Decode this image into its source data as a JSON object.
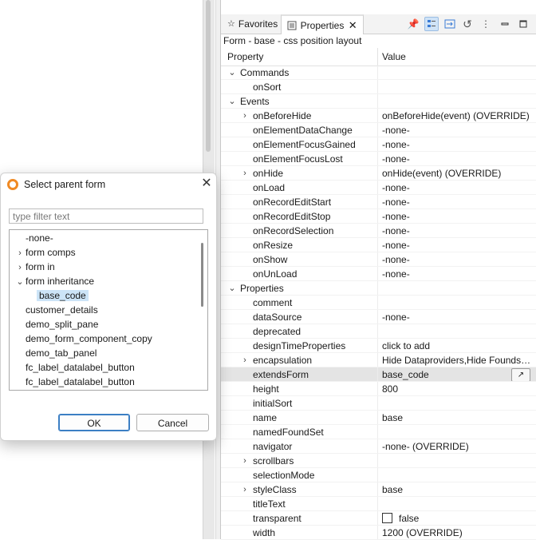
{
  "view_tabs": {
    "favorites": "Favorites",
    "properties": "Properties"
  },
  "properties_view": {
    "subtitle": "Form - base - css position layout",
    "col_property": "Property",
    "col_value": "Value",
    "rows": [
      {
        "name": "Commands",
        "value": "",
        "level": 0,
        "expander": "open"
      },
      {
        "name": "onSort",
        "value": "",
        "level": 1,
        "expander": "none"
      },
      {
        "name": "Events",
        "value": "",
        "level": 0,
        "expander": "open"
      },
      {
        "name": "onBeforeHide",
        "value": "onBeforeHide(event) (OVERRIDE)",
        "level": 1,
        "expander": "closed"
      },
      {
        "name": "onElementDataChange",
        "value": "-none-",
        "level": 1,
        "expander": "none"
      },
      {
        "name": "onElementFocusGained",
        "value": "-none-",
        "level": 1,
        "expander": "none"
      },
      {
        "name": "onElementFocusLost",
        "value": "-none-",
        "level": 1,
        "expander": "none"
      },
      {
        "name": "onHide",
        "value": "onHide(event) (OVERRIDE)",
        "level": 1,
        "expander": "closed"
      },
      {
        "name": "onLoad",
        "value": "-none-",
        "level": 1,
        "expander": "none"
      },
      {
        "name": "onRecordEditStart",
        "value": "-none-",
        "level": 1,
        "expander": "none"
      },
      {
        "name": "onRecordEditStop",
        "value": "-none-",
        "level": 1,
        "expander": "none"
      },
      {
        "name": "onRecordSelection",
        "value": "-none-",
        "level": 1,
        "expander": "none"
      },
      {
        "name": "onResize",
        "value": "-none-",
        "level": 1,
        "expander": "none"
      },
      {
        "name": "onShow",
        "value": "-none-",
        "level": 1,
        "expander": "none"
      },
      {
        "name": "onUnLoad",
        "value": "-none-",
        "level": 1,
        "expander": "none"
      },
      {
        "name": "Properties",
        "value": "",
        "level": 0,
        "expander": "open"
      },
      {
        "name": "comment",
        "value": "",
        "level": 1,
        "expander": "none"
      },
      {
        "name": "dataSource",
        "value": "-none-",
        "level": 1,
        "expander": "none"
      },
      {
        "name": "deprecated",
        "value": "",
        "level": 1,
        "expander": "none"
      },
      {
        "name": "designTimeProperties",
        "value": "click to add",
        "level": 1,
        "expander": "none"
      },
      {
        "name": "encapsulation",
        "value": "Hide Dataproviders,Hide Foundse...",
        "level": 1,
        "expander": "closed"
      },
      {
        "name": "extendsForm",
        "value": "base_code",
        "level": 1,
        "expander": "none",
        "selected": true,
        "browse": true
      },
      {
        "name": "height",
        "value": "800",
        "level": 1,
        "expander": "none"
      },
      {
        "name": "initialSort",
        "value": "",
        "level": 1,
        "expander": "none"
      },
      {
        "name": "name",
        "value": "base",
        "level": 1,
        "expander": "none"
      },
      {
        "name": "namedFoundSet",
        "value": "",
        "level": 1,
        "expander": "none"
      },
      {
        "name": "navigator",
        "value": "-none- (OVERRIDE)",
        "level": 1,
        "expander": "none"
      },
      {
        "name": "scrollbars",
        "value": "",
        "level": 1,
        "expander": "closed"
      },
      {
        "name": "selectionMode",
        "value": "",
        "level": 1,
        "expander": "none"
      },
      {
        "name": "styleClass",
        "value": "base",
        "level": 1,
        "expander": "closed"
      },
      {
        "name": "titleText",
        "value": "",
        "level": 1,
        "expander": "none"
      },
      {
        "name": "transparent",
        "value": "false",
        "level": 1,
        "expander": "none",
        "checkbox": true
      },
      {
        "name": "width",
        "value": "1200 (OVERRIDE)",
        "level": 1,
        "expander": "none"
      }
    ]
  },
  "dialog": {
    "title": "Select parent form",
    "filter_placeholder": "type filter text",
    "items": [
      {
        "label": "-none-",
        "level": 0,
        "expander": "none"
      },
      {
        "label": "form comps",
        "level": 0,
        "expander": "closed"
      },
      {
        "label": "form in",
        "level": 0,
        "expander": "closed"
      },
      {
        "label": "form inheritance",
        "level": 0,
        "expander": "open"
      },
      {
        "label": "base_code",
        "level": 1,
        "expander": "none",
        "selected": true
      },
      {
        "label": "customer_details",
        "level": 0,
        "expander": "none"
      },
      {
        "label": "demo_split_pane",
        "level": 0,
        "expander": "none"
      },
      {
        "label": "demo_form_component_copy",
        "level": 0,
        "expander": "none"
      },
      {
        "label": "demo_tab_panel",
        "level": 0,
        "expander": "none"
      },
      {
        "label": "fc_label_datalabel_button",
        "level": 0,
        "expander": "none"
      },
      {
        "label": "fc_label_datalabel_button",
        "level": 0,
        "expander": "none"
      }
    ],
    "ok_label": "OK",
    "cancel_label": "Cancel"
  },
  "icons": {
    "favorites_tab": "star-icon",
    "properties_tab": "properties-icon",
    "tab_close": "close-icon",
    "toolbar": [
      "pin-icon",
      "categories-icon",
      "advanced-icon",
      "restore-default-icon",
      "view-menu-icon",
      "minimize-icon",
      "maximize-icon"
    ],
    "dialog_logo": "servoy-logo-icon",
    "dialog_close": "close-icon"
  },
  "colors": {
    "selection": "#cce4f7",
    "row_selected": "#e4e4e4",
    "dialog_default_button": "#3c7fc4",
    "logo": "#f08a24"
  }
}
